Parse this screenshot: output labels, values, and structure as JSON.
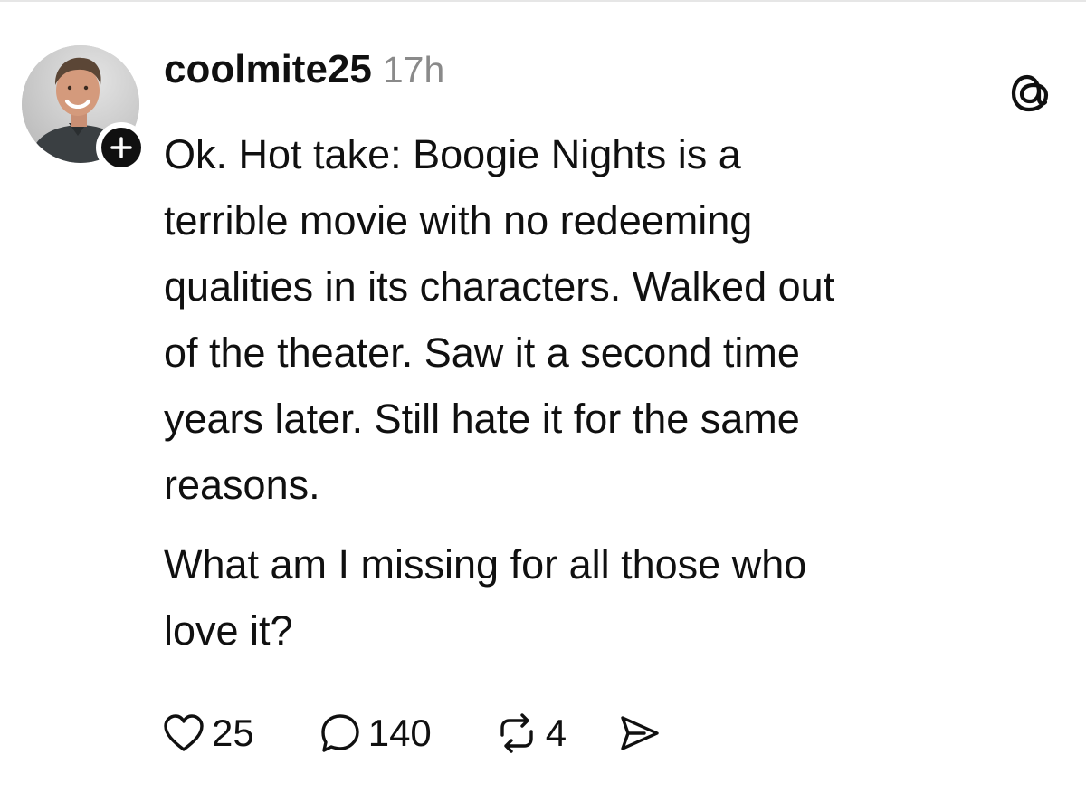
{
  "post": {
    "username": "coolmite25",
    "timestamp": "17h",
    "paragraphs": [
      "Ok. Hot take: Boogie Nights is a\nterrible movie with no redeeming\nqualities in its characters. Walked out\nof the theater. Saw it a second time\nyears later. Still hate it for the same\nreasons.",
      "What am I missing for all those who\nlove it?"
    ]
  },
  "actions": {
    "likes": "25",
    "replies": "140",
    "reposts": "4"
  },
  "icons": {
    "app_logo": "threads-logo-icon",
    "follow": "plus-icon",
    "like": "heart-icon",
    "reply": "speech-bubble-icon",
    "repost": "repost-icon",
    "share": "paper-plane-icon"
  },
  "colors": {
    "text": "#101010",
    "muted": "#8a8a8a",
    "background": "#ffffff"
  }
}
